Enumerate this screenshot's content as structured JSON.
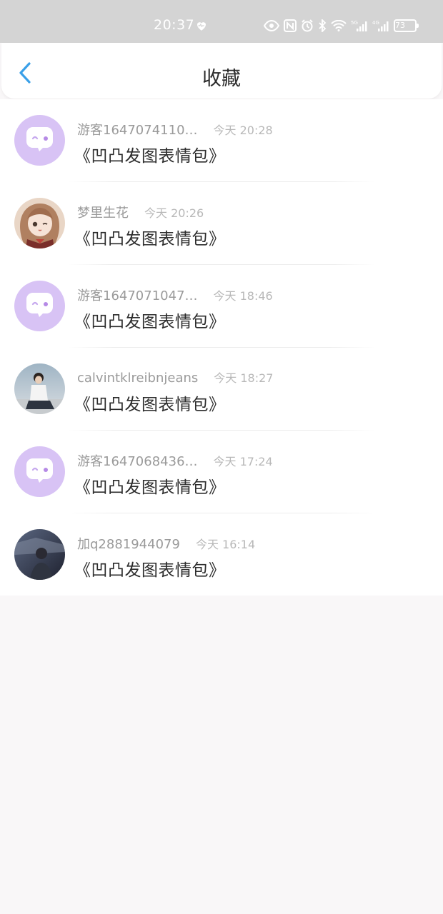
{
  "status_bar": {
    "time": "20:37",
    "battery": "73",
    "icons": [
      "heart-icon",
      "eye-icon",
      "nfc-icon",
      "alarm-icon",
      "bluetooth-icon",
      "wifi-icon",
      "5g-signal-icon",
      "4g-signal-icon",
      "battery-icon"
    ]
  },
  "header": {
    "title": "收藏",
    "back_icon": "chevron-left-icon"
  },
  "colors": {
    "accent": "#3aa0e8",
    "bot_avatar_bg": "#d8c3f5"
  },
  "items": [
    {
      "user": "游客1647074110…",
      "time": "今天 20:28",
      "content": "《凹凸发图表情包》",
      "avatar": "chat-bubble-avatar"
    },
    {
      "user": "梦里生花",
      "time": "今天 20:26",
      "content": "《凹凸发图表情包》",
      "avatar": "anime-girl-avatar"
    },
    {
      "user": "游客1647071047…",
      "time": "今天 18:46",
      "content": "《凹凸发图表情包》",
      "avatar": "chat-bubble-avatar"
    },
    {
      "user": "calvintklreibnjeans",
      "time": "今天 18:27",
      "content": "《凹凸发图表情包》",
      "avatar": "photo-person-avatar"
    },
    {
      "user": "游客1647068436…",
      "time": "今天 17:24",
      "content": "《凹凸发图表情包》",
      "avatar": "chat-bubble-avatar"
    },
    {
      "user": "加q2881944079",
      "time": "今天 16:14",
      "content": "《凹凸发图表情包》",
      "avatar": "dark-photo-avatar"
    }
  ]
}
